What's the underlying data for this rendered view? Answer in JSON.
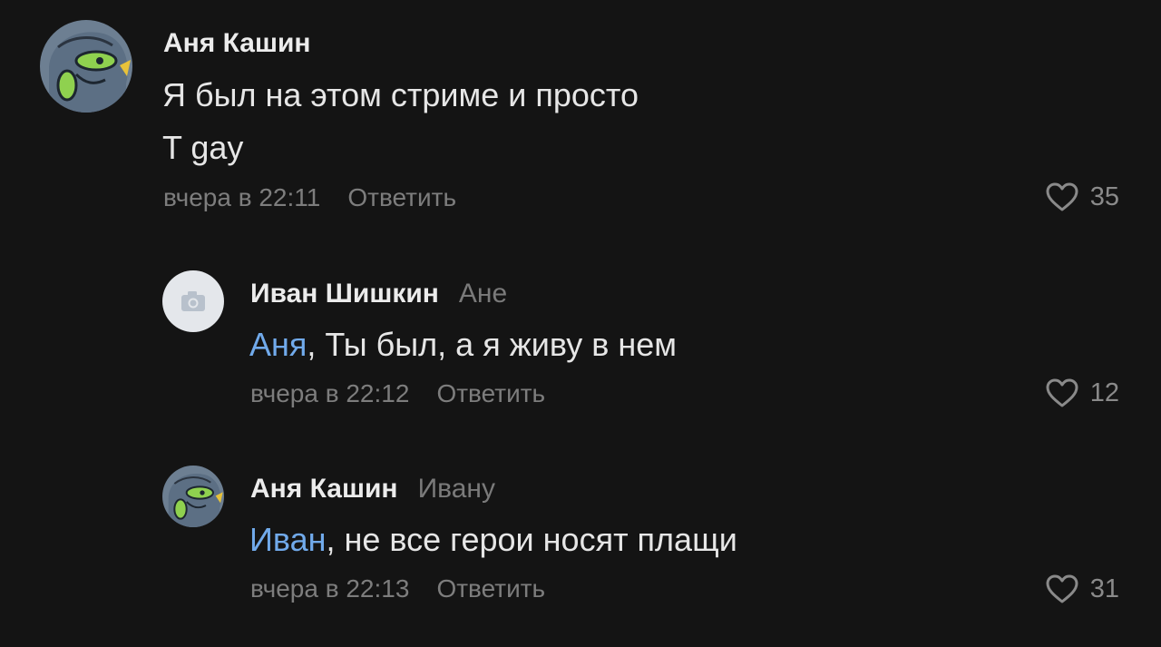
{
  "comments": [
    {
      "author": "Аня Кашин",
      "reply_to": "",
      "mention": "",
      "text_line1": "Я был на этом стриме и просто",
      "text_line2": "T gay",
      "time": "вчера в 22:11",
      "reply_label": "Ответить",
      "likes": "35"
    },
    {
      "author": "Иван Шишкин",
      "reply_to": "Ане",
      "mention": "Аня",
      "text": ", Ты был, а я живу в нем",
      "time": "вчера в 22:12",
      "reply_label": "Ответить",
      "likes": "12"
    },
    {
      "author": "Аня Кашин",
      "reply_to": "Ивану",
      "mention": "Иван",
      "text": ", не все герои носят плащи",
      "time": "вчера в 22:13",
      "reply_label": "Ответить",
      "likes": "31"
    }
  ],
  "colors": {
    "background": "#141414",
    "mention": "#71aaeb",
    "secondary_text": "#7d7d7d"
  },
  "icons": {
    "avatar_placeholder": "camera-icon",
    "like": "heart-icon"
  }
}
